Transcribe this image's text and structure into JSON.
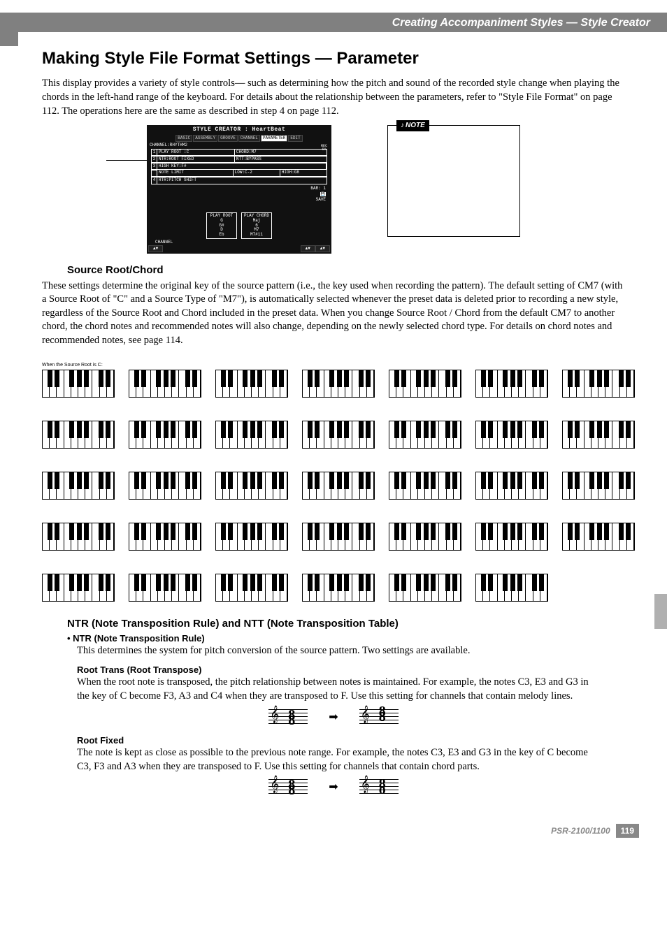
{
  "header": {
    "breadcrumb": "Creating Accompaniment Styles — Style Creator"
  },
  "title": "Making Style File Format Settings — Parameter",
  "intro": "This display provides a variety of style controls— such as determining how the pitch and sound of the recorded style change when playing the chords in the left-hand range of the keyboard. For details about the relationship between the parameters, refer to \"Style File Format\" on page 112. The operations here are the same as described in step 4 on page 112.",
  "lcd": {
    "title": "STYLE CREATOR : HeartBeat",
    "tabs": [
      "BASIC",
      "ASSEMBLY",
      "GROOVE",
      "CHANNEL",
      "PARAMETER",
      "EDIT"
    ],
    "active_tab": "PARAMETER",
    "channel": "CHANNEL:RHYTHM2",
    "rows": [
      {
        "n": "1",
        "left": "PLAY ROOT  :C",
        "right": "CHORD:M7"
      },
      {
        "n": "2",
        "left": "NTR:ROOT FIXED",
        "right": "NTT:BYPASS"
      }
    ],
    "row3": {
      "n": "3",
      "a": "HIGH KEY:F#",
      "b": "NOTE LIMIT",
      "c": "LOW:C-2",
      "d": "HIGH:G8"
    },
    "row4": {
      "n": "4",
      "left": "RTR:PITCH SHIFT",
      "right": ""
    },
    "side": {
      "rec": "REC",
      "ch": "CH"
    },
    "bar": "BAR:    1",
    "save": "SAVE",
    "play_root": {
      "title": "PLAY ROOT",
      "vals": [
        "G",
        "G#",
        "D",
        "Eb"
      ]
    },
    "play_chord": {
      "title": "PLAY CHORD",
      "vals": [
        "Maj",
        "6",
        "M7",
        "M7#11"
      ]
    },
    "footer_channel": "CHANNEL"
  },
  "note": {
    "label": "NOTE",
    "body": ""
  },
  "source": {
    "heading": "Source Root/Chord",
    "body": "These settings determine the original key of the source pattern (i.e., the key used when recording the pattern). The default setting of CM7 (with a Source Root of \"C\" and a Source Type of \"M7\"), is automatically selected whenever the preset data is deleted prior to recording a new style, regardless of the Source Root and Chord included in the preset data. When you change Source Root / Chord from the default CM7 to another chord, the chord notes and recommended notes will also change, depending on the newly selected chord type. For details on chord notes and recommended notes, see page 114."
  },
  "keyboards": {
    "rows": [
      [
        {
          "top": "When the Source Root is C:",
          "sub": ""
        },
        {
          "top": "",
          "sub": ""
        },
        {
          "top": "",
          "sub": ""
        },
        {
          "top": "",
          "sub": ""
        },
        {
          "top": "",
          "sub": ""
        },
        {
          "top": "",
          "sub": ""
        },
        {
          "top": "",
          "sub": ""
        }
      ],
      [
        {
          "top": "",
          "sub": ""
        },
        {
          "top": "",
          "sub": ""
        },
        {
          "top": "",
          "sub": ""
        },
        {
          "top": "",
          "sub": ""
        },
        {
          "top": "",
          "sub": ""
        },
        {
          "top": "",
          "sub": ""
        },
        {
          "top": "",
          "sub": ""
        }
      ],
      [
        {
          "top": "",
          "sub": ""
        },
        {
          "top": "",
          "sub": ""
        },
        {
          "top": "",
          "sub": ""
        },
        {
          "top": "",
          "sub": ""
        },
        {
          "top": "",
          "sub": ""
        },
        {
          "top": "",
          "sub": ""
        },
        {
          "top": "",
          "sub": ""
        }
      ],
      [
        {
          "top": "",
          "sub": ""
        },
        {
          "top": "",
          "sub": ""
        },
        {
          "top": "",
          "sub": ""
        },
        {
          "top": "",
          "sub": ""
        },
        {
          "top": "",
          "sub": ""
        },
        {
          "top": "",
          "sub": ""
        },
        {
          "top": "",
          "sub": ""
        }
      ],
      [
        {
          "top": "",
          "sub": ""
        },
        {
          "top": "",
          "sub": ""
        },
        {
          "top": "",
          "sub": ""
        },
        {
          "top": "",
          "sub": ""
        },
        {
          "top": "",
          "sub": ""
        },
        {
          "top": "",
          "sub": ""
        }
      ]
    ]
  },
  "ntr": {
    "heading": "NTR (Note Transposition Rule) and NTT (Note Transposition Table)",
    "bullet": "• NTR (Note Transposition Rule)",
    "bullet_body": "This determines the system for pitch conversion of the source pattern. Two settings are available.",
    "root_trans": {
      "head": "Root Trans (Root Transpose)",
      "body": "When the root note is transposed, the pitch relationship between notes is maintained. For example, the notes C3, E3 and G3 in the key of C become F3, A3 and C4 when they are transposed to F. Use this setting for channels that contain melody lines."
    },
    "root_fixed": {
      "head": "Root Fixed",
      "body": "The note is kept as close as possible to the previous note range. For example, the notes C3, E3 and G3 in the key of C become C3, F3 and A3 when they are transposed to F. Use this setting for channels that contain chord parts."
    }
  },
  "footer": {
    "model": "PSR-2100/1100",
    "page": "119"
  }
}
